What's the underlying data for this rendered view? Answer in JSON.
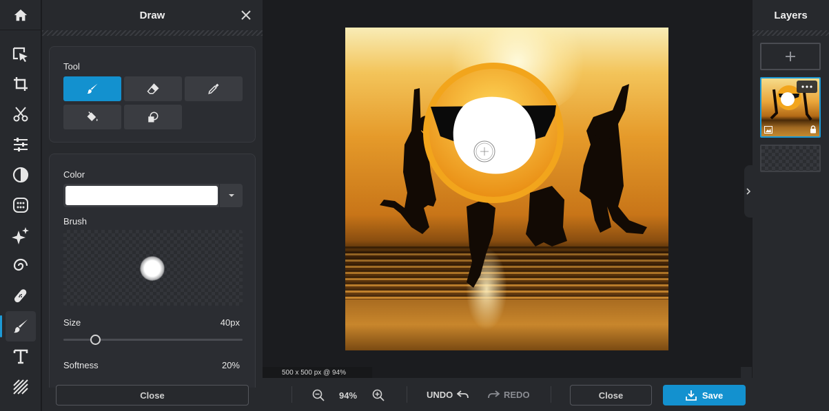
{
  "panel": {
    "title": "Draw",
    "tool_label": "Tool",
    "color_label": "Color",
    "color_value": "#ffffff",
    "brush_label": "Brush",
    "size_label": "Size",
    "size_value": "40px",
    "size_level": 0.18,
    "softness_label": "Softness",
    "softness_value": "20%",
    "close_label": "Close"
  },
  "tools": [
    {
      "name": "brush",
      "icon": "brush-icon",
      "active": true
    },
    {
      "name": "eraser",
      "icon": "eraser-icon",
      "active": false
    },
    {
      "name": "color-picker",
      "icon": "eyedropper-icon",
      "active": false
    },
    {
      "name": "fill",
      "icon": "paint-bucket-icon",
      "active": false
    },
    {
      "name": "shape",
      "icon": "shapes-icon",
      "active": false
    }
  ],
  "toolbar_icons": [
    "home-icon",
    "select-icon",
    "crop-icon",
    "cut-icon",
    "adjust-icon",
    "filter-icon",
    "effects-icon",
    "ai-sparkle-icon",
    "liquify-icon",
    "retouch-icon",
    "draw-icon",
    "text-icon",
    "texture-icon"
  ],
  "canvas": {
    "size_text": "500 x 500 px @ 94%"
  },
  "layers": {
    "title": "Layers"
  },
  "bottom": {
    "zoom": "94%",
    "undo": "UNDO",
    "redo": "REDO",
    "close": "Close",
    "save": "Save"
  },
  "colors": {
    "accent": "#1391cf",
    "sticker_yellow": "#f2a51c"
  }
}
